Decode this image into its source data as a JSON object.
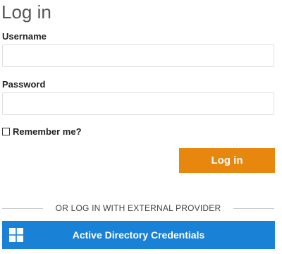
{
  "header": {
    "title": "Log in"
  },
  "form": {
    "username_label": "Username",
    "username_value": "",
    "password_label": "Password",
    "password_value": "",
    "remember_label": "Remember me?",
    "remember_checked": false,
    "login_button": "Log in"
  },
  "external": {
    "divider_text": "OR LOG IN WITH EXTERNAL PROVIDER",
    "provider_button": "Active Directory Credentials",
    "provider_icon": "windows-icon"
  },
  "colors": {
    "login_button": "#e8870d",
    "provider_button": "#1a82d6"
  }
}
